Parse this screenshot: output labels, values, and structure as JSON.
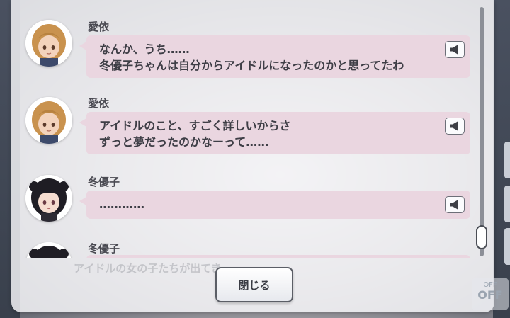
{
  "log": {
    "entries": [
      {
        "speaker": "愛依",
        "lines": [
          "なんか、うち……",
          "冬優子ちゃんは自分からアイドルになったのかと思ってたわ"
        ],
        "avatar": "aii-avatar"
      },
      {
        "speaker": "愛依",
        "lines": [
          "アイドルのこと、すごく詳しいからさ",
          "ずっと夢だったのかなーって……"
        ],
        "avatar": "aii-avatar"
      },
      {
        "speaker": "冬優子",
        "lines": [
          "…………"
        ],
        "avatar": "fuyuko-avatar"
      },
      {
        "speaker": "冬優子",
        "lines": [],
        "avatar": "fuyuko-avatar"
      }
    ],
    "voice_icon": "speaker-icon"
  },
  "background": {
    "ghost_text": "アイドルの女の子たちが出てき……",
    "ghost_label_small": "OFF",
    "ghost_label_big": "OFF"
  },
  "footer": {
    "close_label": "閉じる"
  },
  "colors": {
    "bubble": "#ead6e0",
    "panel": "#f9f9fb",
    "text": "#3e3e46"
  }
}
